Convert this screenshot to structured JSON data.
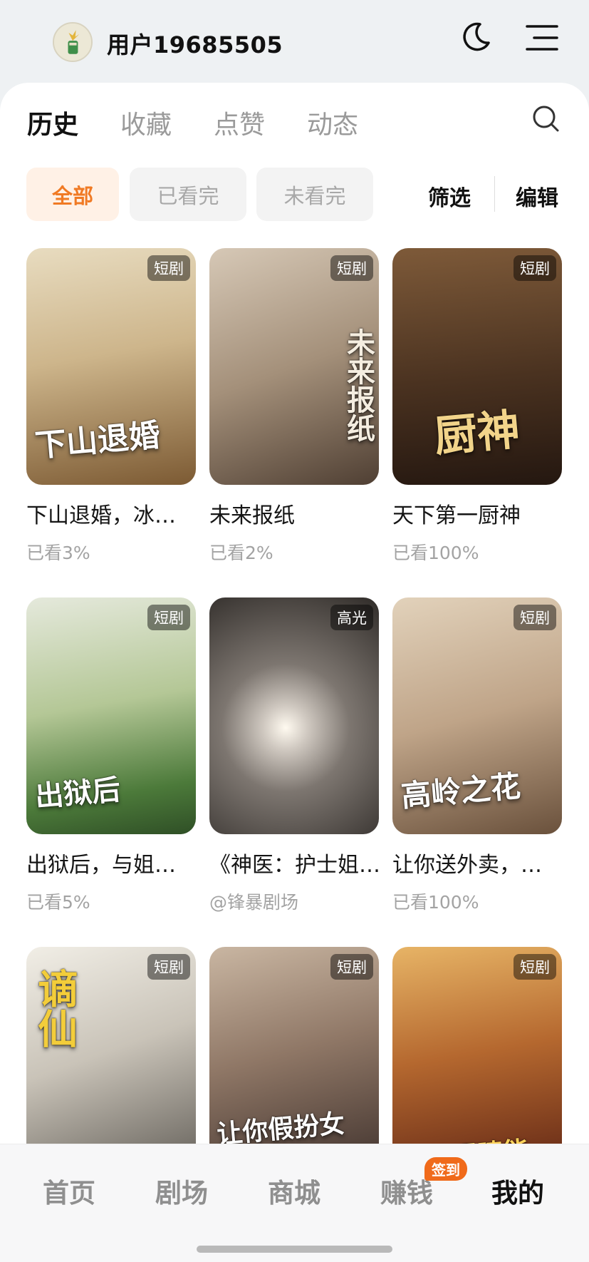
{
  "user": {
    "name": "用户19685505"
  },
  "tabs": [
    {
      "label": "历史",
      "active": true
    },
    {
      "label": "收藏",
      "active": false
    },
    {
      "label": "点赞",
      "active": false
    },
    {
      "label": "动态",
      "active": false
    }
  ],
  "filters": [
    {
      "label": "全部",
      "active": true
    },
    {
      "label": "已看完",
      "active": false
    },
    {
      "label": "未看完",
      "active": false
    }
  ],
  "actions": {
    "filter": "筛选",
    "edit": "编辑"
  },
  "items": [
    {
      "title": "下山退婚，冰…",
      "sub": "已看3%",
      "badge": "短剧",
      "poster_text": "下山退婚",
      "colors": [
        "#d9c9a8",
        "#8a6a3f"
      ]
    },
    {
      "title": "未来报纸",
      "sub": "已看2%",
      "badge": "短剧",
      "poster_text": "未来报纸",
      "colors": [
        "#c7b7a3",
        "#5a4a3c"
      ]
    },
    {
      "title": "天下第一厨神",
      "sub": "已看100%",
      "badge": "短剧",
      "poster_text": "厨神",
      "colors": [
        "#6b4a2e",
        "#2d1d12"
      ]
    },
    {
      "title": "出狱后，与姐…",
      "sub": "已看5%",
      "badge": "短剧",
      "poster_text": "出狱后",
      "colors": [
        "#a9c28a",
        "#3d6a2e"
      ]
    },
    {
      "title": "《神医：护士姐…",
      "sub": "@锋暴剧场",
      "badge": "高光",
      "poster_text": "",
      "colors": [
        "#9a9490",
        "#2b2826"
      ]
    },
    {
      "title": "让你送外卖，…",
      "sub": "已看100%",
      "badge": "短剧",
      "poster_text": "高岭之花",
      "colors": [
        "#cdb79a",
        "#7a5e44"
      ]
    },
    {
      "title": "",
      "sub": "",
      "badge": "短剧",
      "poster_text": "谪仙",
      "colors": [
        "#e6e0d4",
        "#6f6a63"
      ]
    },
    {
      "title": "",
      "sub": "",
      "badge": "短剧",
      "poster_text": "让你假扮女友",
      "colors": [
        "#b7a08c",
        "#3c2f2a"
      ]
    },
    {
      "title": "",
      "sub": "",
      "badge": "短剧",
      "poster_text": "我的眼睛能",
      "colors": [
        "#d79b4f",
        "#6b2a18"
      ]
    }
  ],
  "bottom_nav": [
    {
      "label": "首页",
      "active": false
    },
    {
      "label": "剧场",
      "active": false
    },
    {
      "label": "商城",
      "active": false
    },
    {
      "label": "赚钱",
      "active": false
    },
    {
      "label": "我的",
      "active": true
    }
  ],
  "nav_badge": "签到",
  "colors": {
    "accent": "#f07a24",
    "badge_bg": "#f06a1a"
  }
}
